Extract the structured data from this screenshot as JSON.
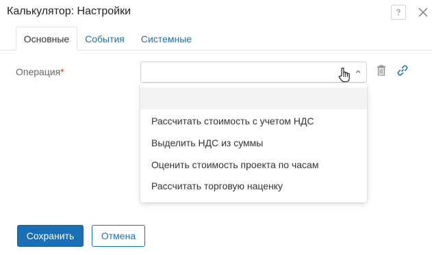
{
  "dialog": {
    "title": "Калькулятор: Настройки",
    "help_icon": "help-icon",
    "close_icon": "close-icon"
  },
  "tabs": [
    {
      "label": "Основные",
      "active": true
    },
    {
      "label": "События",
      "active": false
    },
    {
      "label": "Системные",
      "active": false
    }
  ],
  "field": {
    "label": "Операция",
    "required_mark": "*",
    "value": "",
    "icons": [
      "chevron-up-icon",
      "trash-icon",
      "link-icon"
    ]
  },
  "dropdown": {
    "options": [
      "",
      "Рассчитать стоимость с учетом НДС",
      "Выделить НДС из суммы",
      "Оценить стоимость проекта по часам",
      "Рассчитать торговую наценку"
    ]
  },
  "buttons": {
    "save": "Сохранить",
    "cancel": "Отмена"
  },
  "colors": {
    "accent": "#1a6fb5",
    "required": "#d0312d",
    "highlight": "#f2f2f2"
  }
}
